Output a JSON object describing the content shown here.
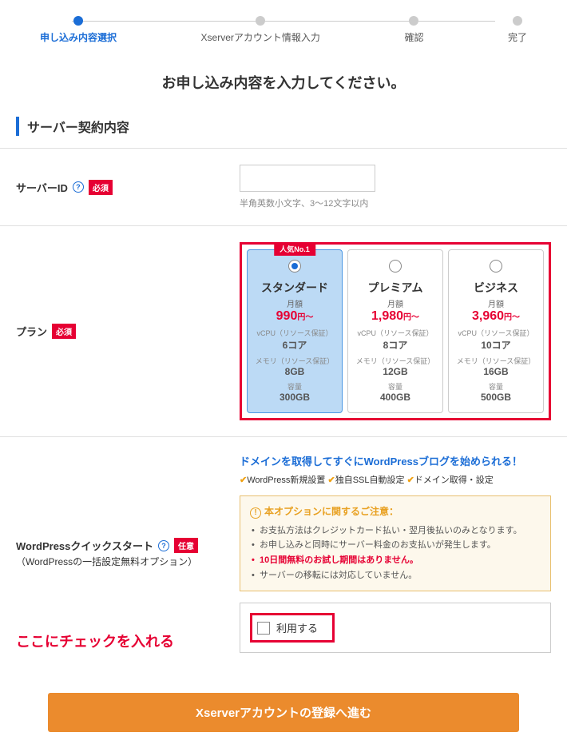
{
  "stepper": {
    "steps": [
      {
        "label": "申し込み内容選択",
        "active": true
      },
      {
        "label": "Xserverアカウント情報入力",
        "active": false
      },
      {
        "label": "確認",
        "active": false
      },
      {
        "label": "完了",
        "active": false
      }
    ]
  },
  "page_title": "お申し込み内容を入力してください。",
  "section_title": "サーバー契約内容",
  "labels": {
    "required": "必須",
    "optional": "任意"
  },
  "server_id": {
    "label": "サーバーID",
    "value": "",
    "note": "半角英数小文字、3～12文字以内"
  },
  "plan": {
    "label": "プラン",
    "popular_badge": "人気No.1",
    "monthly_label": "月額",
    "price_suffix": "円～",
    "spec_vcpu_label": "vCPU（リソース保証）",
    "spec_mem_label": "メモリ（リソース保証）",
    "spec_cap_label": "容量",
    "options": [
      {
        "name": "スタンダード",
        "price": "990",
        "vcpu": "6コア",
        "mem": "8GB",
        "cap": "300GB",
        "selected": true,
        "popular": true
      },
      {
        "name": "プレミアム",
        "price": "1,980",
        "vcpu": "8コア",
        "mem": "12GB",
        "cap": "400GB",
        "selected": false,
        "popular": false
      },
      {
        "name": "ビジネス",
        "price": "3,960",
        "vcpu": "10コア",
        "mem": "16GB",
        "cap": "500GB",
        "selected": false,
        "popular": false
      }
    ]
  },
  "quickstart": {
    "label": "WordPressクイックスタート",
    "sublabel": "（WordPressの一括設定無料オプション）",
    "title": "ドメインを取得してすぐにWordPressブログを始められる！",
    "features": [
      "WordPress新規設置",
      "独自SSL自動設定",
      "ドメイン取得・設定"
    ],
    "caution_title": "本オプションに関するご注意：",
    "cautions": [
      {
        "text": "お支払方法はクレジットカード払い・翌月後払いのみとなります。",
        "red": false
      },
      {
        "text": "お申し込みと同時にサーバー料金のお支払いが発生します。",
        "red": false
      },
      {
        "text": "10日間無料のお試し期間はありません。",
        "red": true
      },
      {
        "text": "サーバーの移転には対応していません。",
        "red": false
      }
    ],
    "checkbox_label": "利用する"
  },
  "annotation": "ここにチェックを入れる",
  "submit": "Xserverアカウントの登録へ進む"
}
